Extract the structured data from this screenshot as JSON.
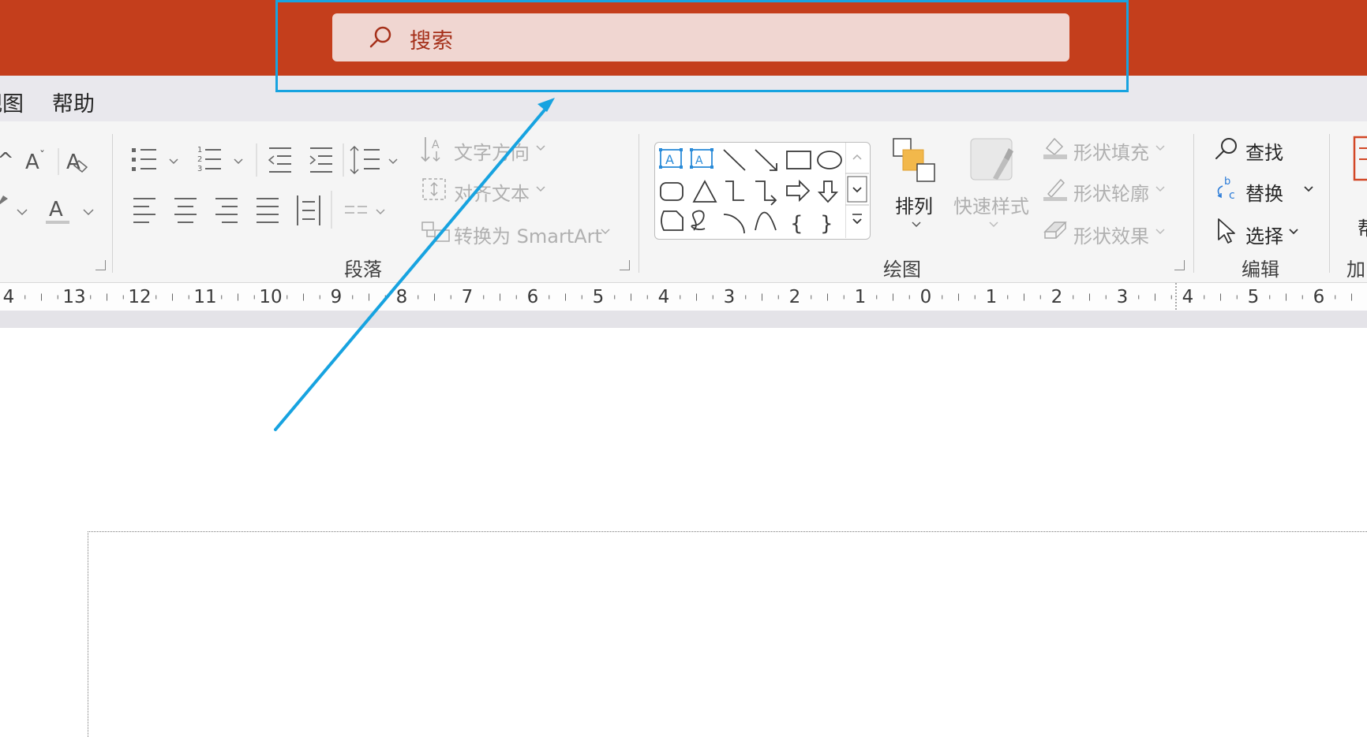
{
  "search": {
    "text": "搜索"
  },
  "tabs": {
    "view_partial": "视图",
    "help": "帮助"
  },
  "ribbon": {
    "paragraph": {
      "label": "段落",
      "text_direction": "文字方向",
      "align_text": "对齐文本",
      "convert_smartart": "转换为 SmartArt"
    },
    "drawing": {
      "label": "绘图",
      "arrange": "排列",
      "quick_styles": "快速样式",
      "shape_fill": "形状填充",
      "shape_outline": "形状轮廓",
      "shape_effects": "形状效果"
    },
    "editing": {
      "label": "编辑",
      "find": "查找",
      "replace": "替换",
      "select": "选择"
    },
    "addins_partial": "加",
    "right_cut": "帮"
  },
  "ruler": {
    "labels": [
      "4",
      "13",
      "12",
      "11",
      "10",
      "9",
      "8",
      "7",
      "6",
      "5",
      "4",
      "3",
      "2",
      "1",
      "0",
      "1",
      "2",
      "3",
      "4",
      "5",
      "6"
    ]
  },
  "colors": {
    "titlebar": "#c43e1c",
    "search_bg": "#f0d6d1",
    "annotation": "#17a3e0"
  }
}
